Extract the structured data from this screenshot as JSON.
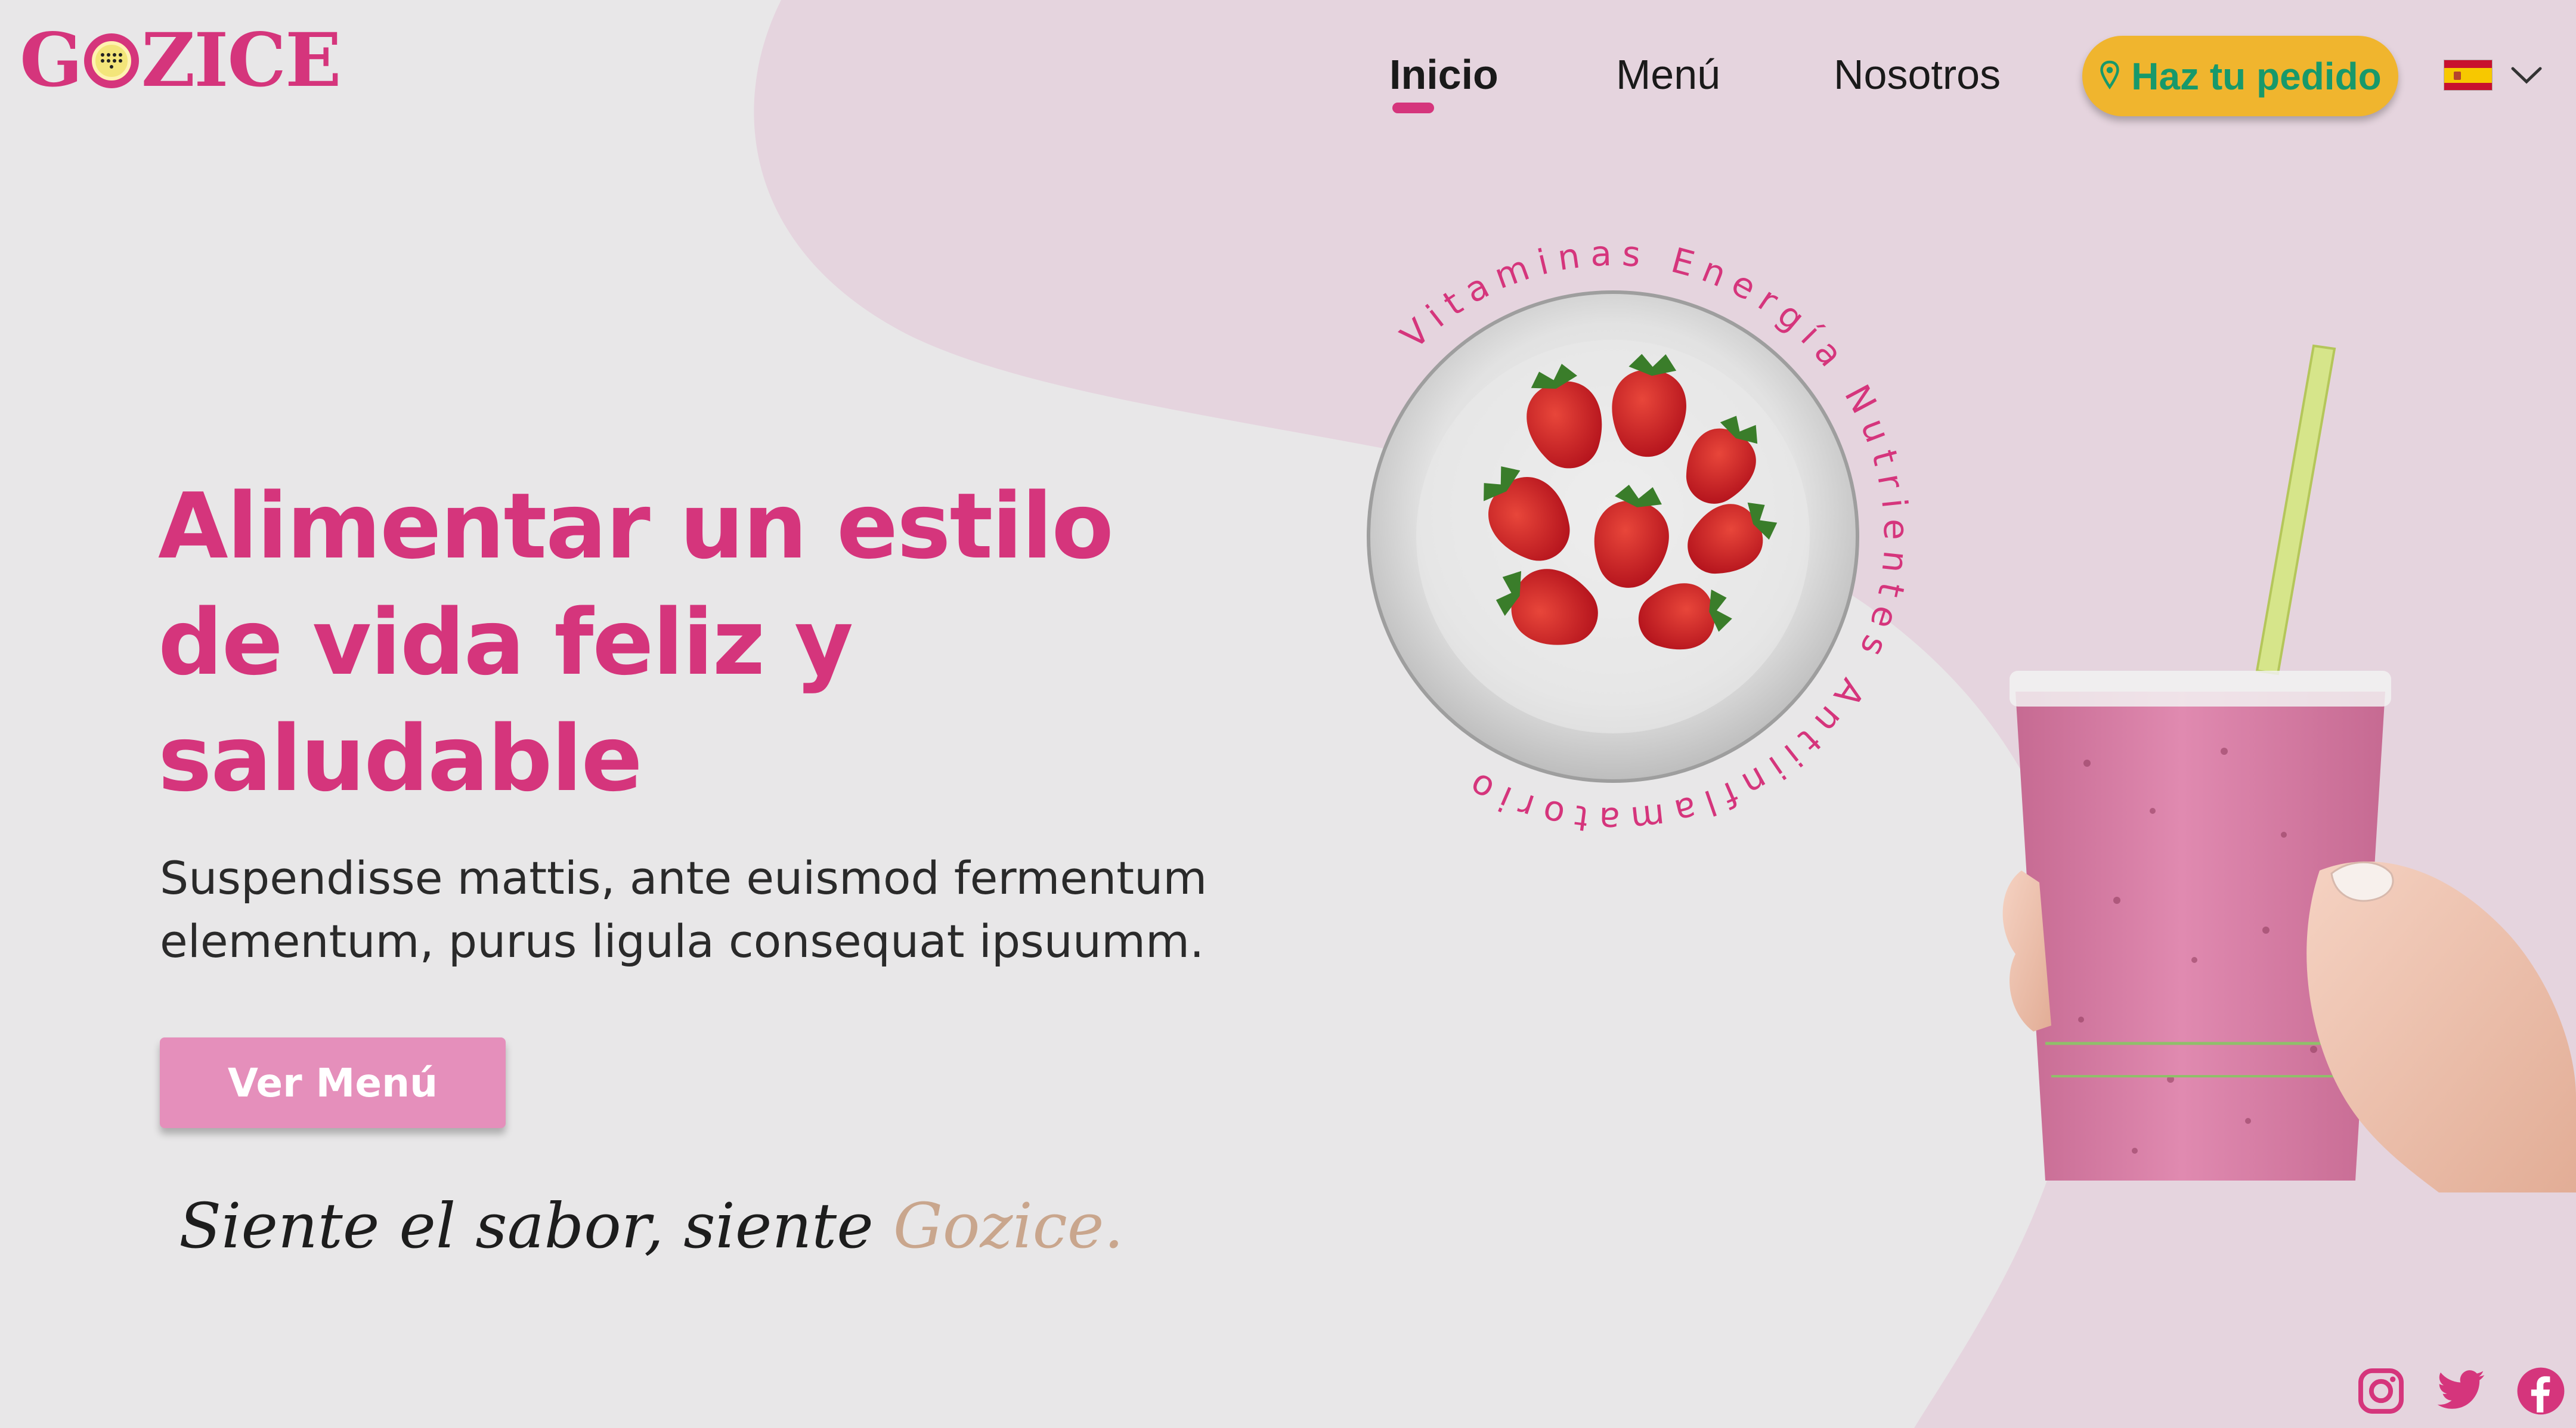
{
  "brand": {
    "name_left": "G",
    "name_right": "ZICE"
  },
  "nav": {
    "items": [
      {
        "label": "Inicio",
        "active": true
      },
      {
        "label": "Menú",
        "active": false
      },
      {
        "label": "Nosotros",
        "active": false
      }
    ],
    "order_button": "Haz tu pedido",
    "language": {
      "flag": "spain-flag",
      "icon": "chevron-down-icon"
    }
  },
  "hero": {
    "title_lines": [
      "Alimentar un estilo",
      "de vida feliz y",
      "saludable"
    ],
    "subtitle_lines": [
      "Suspendisse mattis, ante euismod fermentum",
      "elementum, purus ligula consequat ipsuumm."
    ],
    "cta": "Ver Menú",
    "tagline": "Siente el sabor, siente ",
    "tagline_brand": "Gozice."
  },
  "ring_text": "Vitaminas  Energía  Nutrientes  Antiinflamatorio",
  "social": [
    "instagram-icon",
    "twitter-icon",
    "facebook-icon"
  ],
  "colors": {
    "accent": "#d5357c",
    "button_pink": "#e58fbb",
    "order_yellow": "#f0b52e",
    "order_text": "#17996b",
    "blob": "#e5d4de",
    "background": "#e8e7e8"
  }
}
